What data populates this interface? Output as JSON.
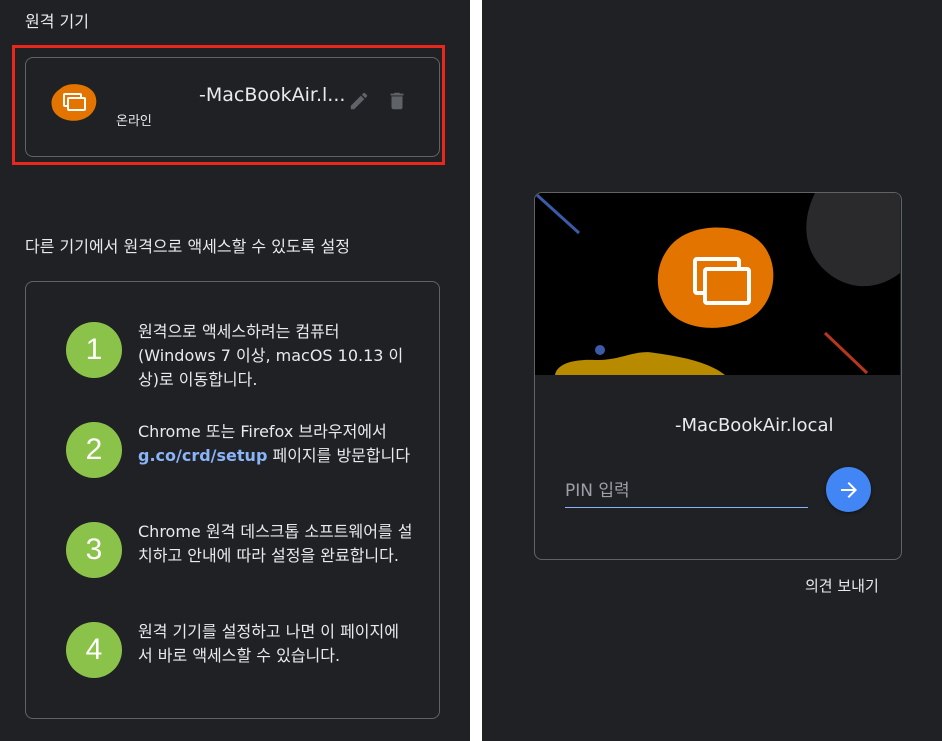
{
  "left_panel": {
    "devices_title": "원격 기기",
    "device": {
      "name": "-MacBookAir.l...",
      "status": "온라인",
      "icon": "remote-desktop-icon",
      "edit_icon": "pencil-icon",
      "delete_icon": "trash-icon"
    },
    "setup_title": "다른 기기에서 원격으로 액세스할 수 있도록 설정",
    "steps": [
      {
        "number": "1",
        "text": "원격으로 액세스하려는 컴퓨터 (Windows 7 이상, macOS 10.13 이상)로 이동합니다."
      },
      {
        "number": "2",
        "text_before": "Chrome 또는 Firefox 브라우저에서 ",
        "link": "g.co/crd/setup",
        "text_after": " 페이지를 방문합니다"
      },
      {
        "number": "3",
        "text": "Chrome 원격 데스크톱 소프트웨어를 설치하고 안내에 따라 설정을 완료합니다."
      },
      {
        "number": "4",
        "text": "원격 기기를 설정하고 나면 이 페이지에서 바로 액세스할 수 있습니다."
      }
    ]
  },
  "right_panel": {
    "device_name": "-MacBookAir.local",
    "pin_placeholder": "PIN 입력",
    "connect_icon": "arrow-right-icon",
    "feedback_label": "의견 보내기"
  },
  "colors": {
    "background": "#202124",
    "accent_orange": "#e37400",
    "step_green": "#8bc34a",
    "link_blue": "#8ab4f8",
    "button_blue": "#4285f4",
    "highlight_red": "#e8281c"
  }
}
